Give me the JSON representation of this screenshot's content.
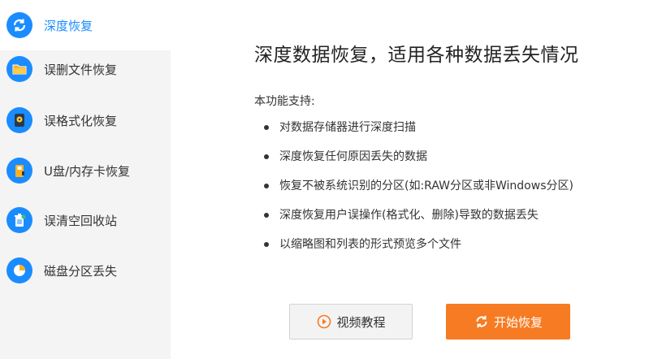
{
  "sidebar": {
    "items": [
      {
        "label": "深度恢复",
        "icon": "deep-recovery-icon",
        "active": true
      },
      {
        "label": "误删文件恢复",
        "icon": "folder-icon",
        "active": false
      },
      {
        "label": "误格式化恢复",
        "icon": "disk-icon",
        "active": false
      },
      {
        "label": "U盘/内存卡恢复",
        "icon": "usb-drive-icon",
        "active": false
      },
      {
        "label": "误清空回收站",
        "icon": "recycle-bin-icon",
        "active": false
      },
      {
        "label": "磁盘分区丢失",
        "icon": "partition-pie-icon",
        "active": false
      }
    ]
  },
  "main": {
    "title": "深度数据恢复，适用各种数据丢失情况",
    "support_label": "本功能支持:",
    "features": [
      "对数据存储器进行深度扫描",
      "深度恢复任何原因丢失的数据",
      "恢复不被系统识别的分区(如:RAW分区或非Windows分区)",
      "深度恢复用户误操作(格式化、删除)导致的数据丢失",
      "以缩略图和列表的形式预览多个文件"
    ]
  },
  "buttons": {
    "video_tutorial": "视频教程",
    "start_recovery": "开始恢复"
  },
  "colors": {
    "accent_blue": "#1a8cff",
    "icon_blue": "#1a8cff",
    "start_orange": "#f77b22",
    "sidebar_bg": "#f4f4f4"
  }
}
